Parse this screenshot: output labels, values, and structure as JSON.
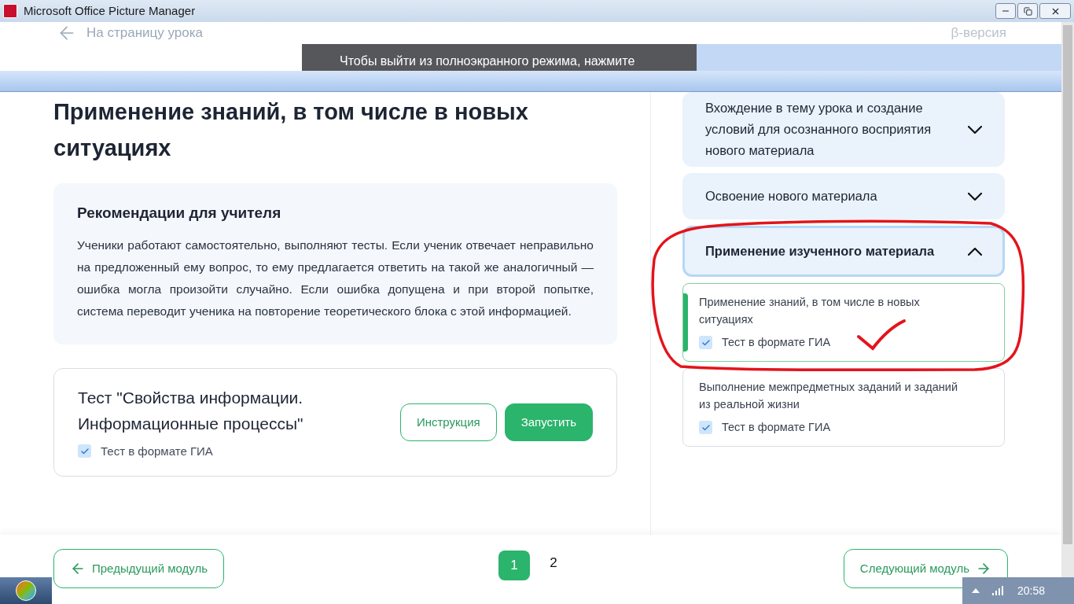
{
  "window": {
    "title": "Microsoft Office Picture Manager"
  },
  "header": {
    "back_link": "На страницу урока",
    "beta": "β-версия"
  },
  "fullscreen_notice": "Чтобы выйти из полноэкранного режима, нажмите",
  "lesson_title": "Применение знаний, в том числе в новых ситуациях",
  "recommendations": {
    "title": "Рекомендации для учителя",
    "text": "Ученики работают самостоятельно, выполняют тесты. Если ученик отвечает неправильно на предложенный ему вопрос, то ему предлагается ответить на такой же аналогичный — ошибка могла произойти случайно. Если ошибка допущена и при второй попытке, система переводит ученика на повторение теоретического блока с этой информацией."
  },
  "test": {
    "title": "Тест \"Свойства информации. Информационные процессы\"",
    "gia_label": "Тест в формате ГИА",
    "checked": true,
    "buttons": [
      {
        "label": "Инструкция",
        "kind": "outline"
      },
      {
        "label": "Запустить",
        "kind": "primary"
      }
    ]
  },
  "stages": [
    {
      "title": "Вхождение в тему урока и создание условий для осознанного восприятия нового материала",
      "expanded": false,
      "selected": false
    },
    {
      "title": "Освоение нового материала",
      "expanded": false,
      "selected": false
    },
    {
      "title": "Применение изученного материала",
      "expanded": true,
      "selected": true,
      "children": [
        {
          "title": "Применение знаний, в том числе в новых ситуациях",
          "selected": true,
          "test_label": "Тест в формате ГИА",
          "checked": true
        },
        {
          "title": "Выполнение межпредметных заданий и заданий из реальной жизни",
          "selected": false,
          "test_label": "Тест в формате ГИА",
          "checked": true
        }
      ]
    }
  ],
  "footer": {
    "prev": "Предыдущий модуль",
    "next": "Следующий модуль",
    "pages": [
      {
        "label": "1",
        "selected": true
      },
      {
        "label": "2",
        "selected": false
      }
    ]
  },
  "taskbar": {
    "clock": "20:58"
  }
}
